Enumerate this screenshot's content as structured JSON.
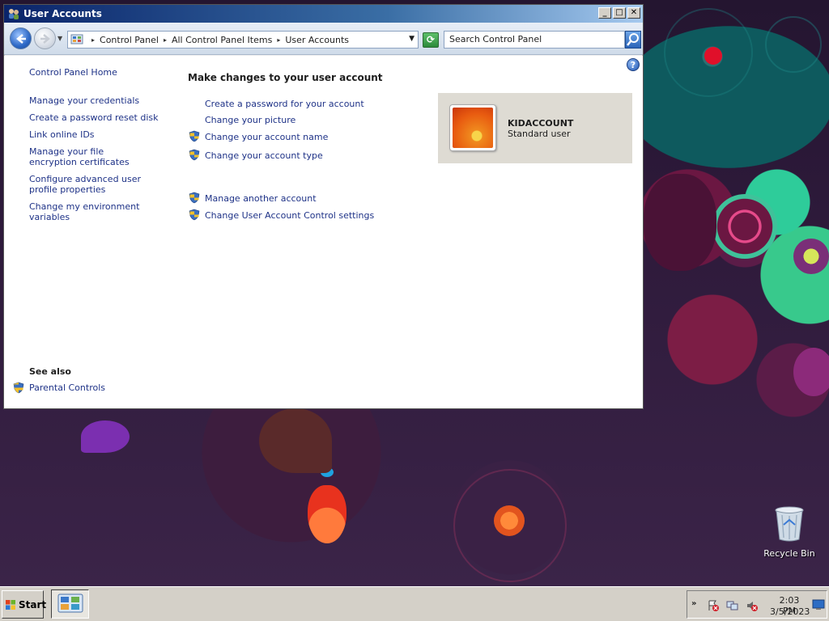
{
  "window": {
    "title": "User Accounts",
    "caption_buttons": {
      "minimize": "_",
      "maximize": "□",
      "close": "✕"
    }
  },
  "address_bar": {
    "breadcrumb": [
      "Control Panel",
      "All Control Panel Items",
      "User Accounts"
    ],
    "search_placeholder": "Search Control Panel"
  },
  "left_pane": {
    "home_link": "Control Panel Home",
    "links": [
      "Manage your credentials",
      "Create a password reset disk",
      "Link online IDs",
      "Manage your file encryption certificates",
      "Configure advanced user profile properties",
      "Change my environment variables"
    ],
    "see_also_heading": "See also",
    "see_also_links": [
      "Parental Controls"
    ]
  },
  "main": {
    "heading": "Make changes to your user account",
    "links": [
      "Create a password for your account",
      "Change your picture",
      "Change your account name",
      "Change your account type"
    ],
    "other_links": [
      "Manage another account",
      "Change User Account Control settings"
    ]
  },
  "account": {
    "name": "KIDACCOUNT",
    "type": "Standard user"
  },
  "desktop": {
    "recycle_bin_label": "Recycle Bin"
  },
  "taskbar": {
    "start_label": "Start",
    "clock_time": "2:03 PM",
    "clock_date": "3/5/2023"
  },
  "icons": {
    "help": "?",
    "tray_expand": "»"
  }
}
